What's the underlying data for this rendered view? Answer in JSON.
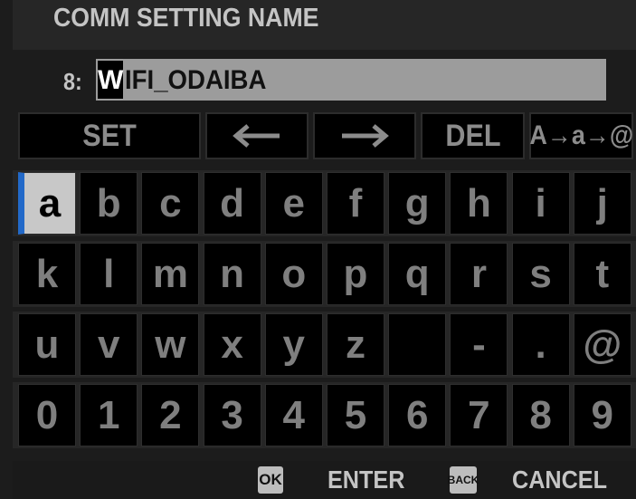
{
  "header": {
    "title": "COMM SETTING NAME"
  },
  "name_entry": {
    "slot_label": "8:",
    "cursor_char": "W",
    "remaining_text": "IFI_ODAIBA"
  },
  "function_keys": {
    "set_label": "SET",
    "left_icon": "left-arrow-icon",
    "right_icon": "right-arrow-icon",
    "del_label": "DEL",
    "case_toggle_label": "A→a→@"
  },
  "keyboard": {
    "selected_key": "a",
    "rows": [
      [
        "a",
        "b",
        "c",
        "d",
        "e",
        "f",
        "g",
        "h",
        "i",
        "j"
      ],
      [
        "k",
        "l",
        "m",
        "n",
        "o",
        "p",
        "q",
        "r",
        "s",
        "t"
      ],
      [
        "u",
        "v",
        "w",
        "x",
        "y",
        "z",
        "",
        "-",
        ".",
        "@"
      ],
      [
        "0",
        "1",
        "2",
        "3",
        "4",
        "5",
        "6",
        "7",
        "8",
        "9"
      ]
    ]
  },
  "footer": {
    "ok_icon_label": "OK",
    "enter_label": "ENTER",
    "back_icon_label": "BACK",
    "cancel_label": "CANCEL"
  },
  "colors": {
    "selection_accent": "#2269c9",
    "key_background": "#000000",
    "selected_key_background": "#c8c8c8"
  }
}
